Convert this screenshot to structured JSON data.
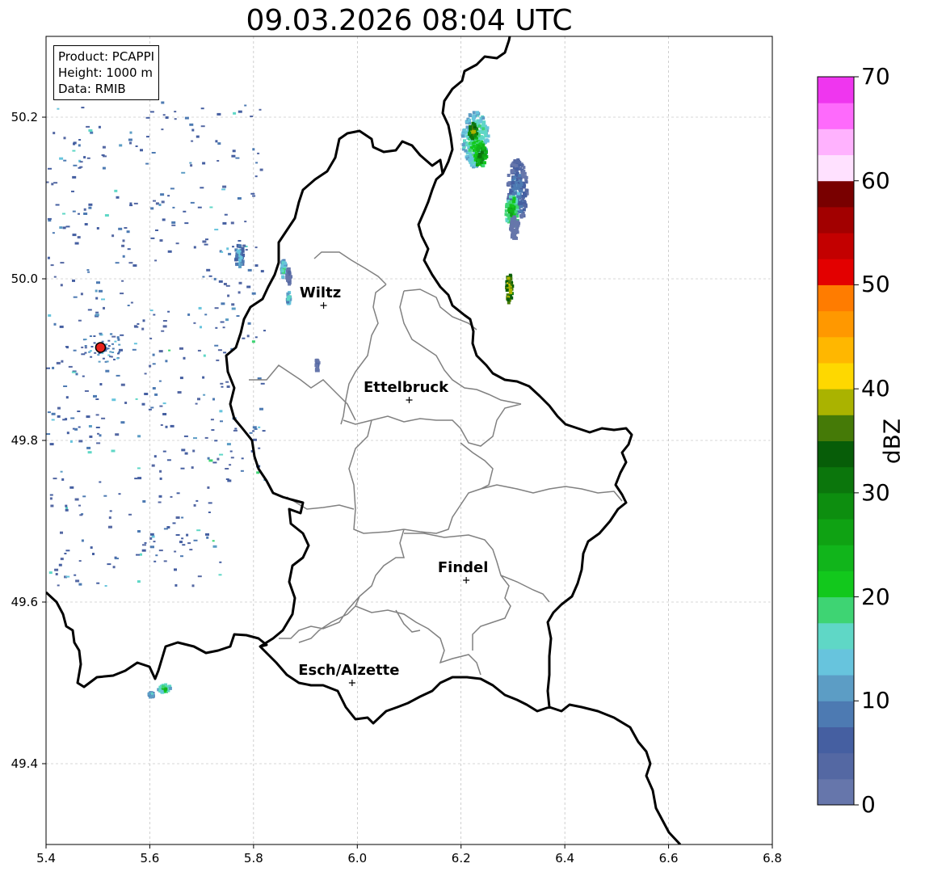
{
  "title": "09.03.2026 08:04 UTC",
  "info_box": [
    "Product: PCAPPI",
    "Height: 1000 m",
    "Data: RMIB"
  ],
  "axes": {
    "x_ticks": [
      "5.4",
      "5.6",
      "5.8",
      "6.0",
      "6.2",
      "6.4",
      "6.6",
      "6.8"
    ],
    "x_values": [
      5.4,
      5.6,
      5.8,
      6.0,
      6.2,
      6.4,
      6.6,
      6.8
    ],
    "y_ticks": [
      "50.2",
      "50.0",
      "49.8",
      "49.6",
      "49.4"
    ],
    "y_values": [
      50.2,
      50.0,
      49.8,
      49.6,
      49.4
    ],
    "xlim": [
      5.4,
      6.8
    ],
    "ylim": [
      49.3,
      50.3
    ],
    "grid": true
  },
  "cities": [
    {
      "name": "Wiltz",
      "lon": 5.935,
      "lat": 49.967
    },
    {
      "name": "Ettelbruck",
      "lon": 6.1,
      "lat": 49.85
    },
    {
      "name": "Findel",
      "lon": 6.21,
      "lat": 49.627
    },
    {
      "name": "Esch/Alzette",
      "lon": 5.99,
      "lat": 49.5
    }
  ],
  "radar_site": {
    "lon": 5.505,
    "lat": 49.915,
    "color": "#e8221c"
  },
  "colorbar": {
    "label": "dBZ",
    "ticks": [
      "0",
      "10",
      "20",
      "30",
      "40",
      "50",
      "60",
      "70"
    ],
    "tick_values": [
      0,
      10,
      20,
      30,
      40,
      50,
      60,
      70
    ],
    "range": [
      0,
      70
    ],
    "step": 2.5,
    "colors": [
      "#6676ab",
      "#5468a3",
      "#455fa1",
      "#4d7ab2",
      "#5c9dc5",
      "#67c4dd",
      "#5fd7c6",
      "#3ed473",
      "#12c81c",
      "#11b51b",
      "#0fa213",
      "#0d8e0f",
      "#0b760c",
      "#075d08",
      "#457a07",
      "#aab300",
      "#fed800",
      "#ffb700",
      "#ff9800",
      "#ff7c00",
      "#e30000",
      "#c30000",
      "#a20000",
      "#790000",
      "#ffe1ff",
      "#ffb2fe",
      "#fe6afc",
      "#ef36ef"
    ]
  },
  "colors": {
    "border": "#000000",
    "canton": "#808080",
    "grid": "#b0b0b0"
  },
  "echo_cells": [
    {
      "lon": 6.225,
      "lat": 50.175,
      "rx": 0.025,
      "ry": 0.035,
      "dbz": 22
    },
    {
      "lon": 6.235,
      "lat": 50.155,
      "rx": 0.012,
      "ry": 0.015,
      "dbz": 32
    },
    {
      "lon": 6.22,
      "lat": 50.185,
      "rx": 0.008,
      "ry": 0.01,
      "dbz": 40
    },
    {
      "lon": 6.305,
      "lat": 50.11,
      "rx": 0.02,
      "ry": 0.04,
      "dbz": 12
    },
    {
      "lon": 6.295,
      "lat": 50.085,
      "rx": 0.012,
      "ry": 0.02,
      "dbz": 27
    },
    {
      "lon": 6.3,
      "lat": 50.065,
      "rx": 0.008,
      "ry": 0.015,
      "dbz": 5
    },
    {
      "lon": 6.29,
      "lat": 49.99,
      "rx": 0.006,
      "ry": 0.018,
      "dbz": 43
    },
    {
      "lon": 5.77,
      "lat": 50.03,
      "rx": 0.008,
      "ry": 0.015,
      "dbz": 17
    },
    {
      "lon": 5.855,
      "lat": 50.015,
      "rx": 0.005,
      "ry": 0.012,
      "dbz": 20
    },
    {
      "lon": 5.865,
      "lat": 50.005,
      "rx": 0.004,
      "ry": 0.01,
      "dbz": 6
    },
    {
      "lon": 5.625,
      "lat": 49.495,
      "rx": 0.012,
      "ry": 0.005,
      "dbz": 24
    },
    {
      "lon": 5.6,
      "lat": 49.487,
      "rx": 0.005,
      "ry": 0.003,
      "dbz": 18
    },
    {
      "lon": 5.865,
      "lat": 49.978,
      "rx": 0.003,
      "ry": 0.008,
      "dbz": 20
    },
    {
      "lon": 5.92,
      "lat": 49.895,
      "rx": 0.003,
      "ry": 0.008,
      "dbz": 6
    }
  ]
}
